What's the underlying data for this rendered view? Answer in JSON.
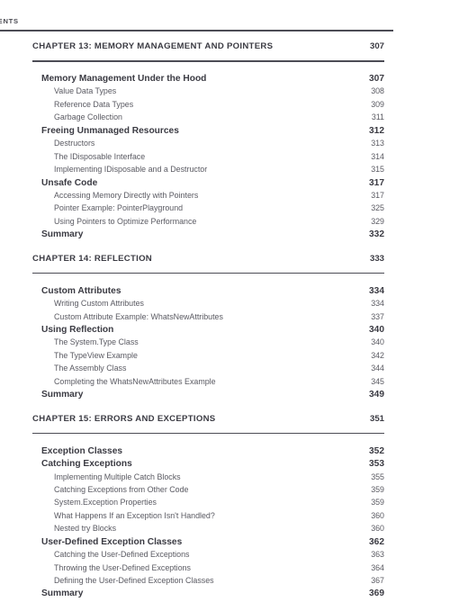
{
  "running_head": "NTENTS",
  "page_column_header": "",
  "colors": {
    "heading_text": "#3b3b43",
    "subentry_text": "#5a5a62",
    "rule": "#4c4c55",
    "background": "#ffffff"
  },
  "chapters": [
    {
      "title": "CHAPTER 13: MEMORY MANAGEMENT AND POINTERS",
      "page": "307",
      "entries": [
        {
          "level": 1,
          "label": "Memory Management Under the Hood",
          "page": "307"
        },
        {
          "level": 2,
          "label": "Value Data Types",
          "page": "308"
        },
        {
          "level": 2,
          "label": "Reference Data Types",
          "page": "309"
        },
        {
          "level": 2,
          "label": "Garbage Collection",
          "page": "311"
        },
        {
          "level": 1,
          "label": "Freeing Unmanaged Resources",
          "page": "312"
        },
        {
          "level": 2,
          "label": "Destructors",
          "page": "313"
        },
        {
          "level": 2,
          "label": "The IDisposable Interface",
          "page": "314"
        },
        {
          "level": 2,
          "label": "Implementing IDisposable and a Destructor",
          "page": "315"
        },
        {
          "level": 1,
          "label": "Unsafe Code",
          "page": "317"
        },
        {
          "level": 2,
          "label": "Accessing Memory Directly with Pointers",
          "page": "317"
        },
        {
          "level": 2,
          "label": "Pointer Example: PointerPlayground",
          "page": "325"
        },
        {
          "level": 2,
          "label": "Using Pointers to Optimize Performance",
          "page": "329"
        },
        {
          "level": 1,
          "label": "Summary",
          "page": "332"
        }
      ]
    },
    {
      "title": "CHAPTER 14: REFLECTION",
      "page": "333",
      "entries": [
        {
          "level": 1,
          "label": "Custom Attributes",
          "page": "334"
        },
        {
          "level": 2,
          "label": "Writing Custom Attributes",
          "page": "334"
        },
        {
          "level": 2,
          "label": "Custom Attribute Example: WhatsNewAttributes",
          "page": "337"
        },
        {
          "level": 1,
          "label": "Using Reflection",
          "page": "340"
        },
        {
          "level": 2,
          "label": "The System.Type Class",
          "page": "340"
        },
        {
          "level": 2,
          "label": "The TypeView Example",
          "page": "342"
        },
        {
          "level": 2,
          "label": "The Assembly Class",
          "page": "344"
        },
        {
          "level": 2,
          "label": "Completing the WhatsNewAttributes Example",
          "page": "345"
        },
        {
          "level": 1,
          "label": "Summary",
          "page": "349"
        }
      ]
    },
    {
      "title": "CHAPTER 15: ERRORS AND EXCEPTIONS",
      "page": "351",
      "entries": [
        {
          "level": 1,
          "label": "Exception Classes",
          "page": "352"
        },
        {
          "level": 1,
          "label": "Catching Exceptions",
          "page": "353"
        },
        {
          "level": 2,
          "label": "Implementing Multiple Catch Blocks",
          "page": "355"
        },
        {
          "level": 2,
          "label": "Catching Exceptions from Other Code",
          "page": "359"
        },
        {
          "level": 2,
          "label": "System.Exception Properties",
          "page": "359"
        },
        {
          "level": 2,
          "label": "What Happens If an Exception Isn't Handled?",
          "page": "360"
        },
        {
          "level": 2,
          "label": "Nested try Blocks",
          "page": "360"
        },
        {
          "level": 1,
          "label": "User-Defined Exception Classes",
          "page": "362"
        },
        {
          "level": 2,
          "label": "Catching the User-Defined Exceptions",
          "page": "363"
        },
        {
          "level": 2,
          "label": "Throwing the User-Defined Exceptions",
          "page": "364"
        },
        {
          "level": 2,
          "label": "Defining the User-Defined Exception Classes",
          "page": "367"
        },
        {
          "level": 1,
          "label": "Summary",
          "page": "369"
        }
      ]
    }
  ]
}
